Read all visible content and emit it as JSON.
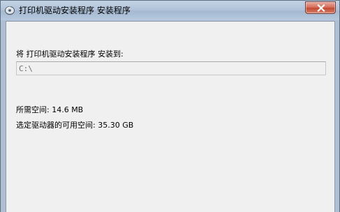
{
  "window": {
    "title": "打印机驱动安装程序 安装程序",
    "icon": "installer-disc-icon",
    "close_icon": "close-icon"
  },
  "install": {
    "install_to_label": "将 打印机驱动安装程序 安装到:",
    "path_value": "C:\\",
    "required_space_label": "所需空间: 14.6 MB",
    "available_space_label": "选定驱动器的可用空间: 35.30 GB"
  },
  "colors": {
    "title_bar": "#b2c4da",
    "client_bg": "#f0f0f0",
    "close_button": "#c24b35"
  }
}
